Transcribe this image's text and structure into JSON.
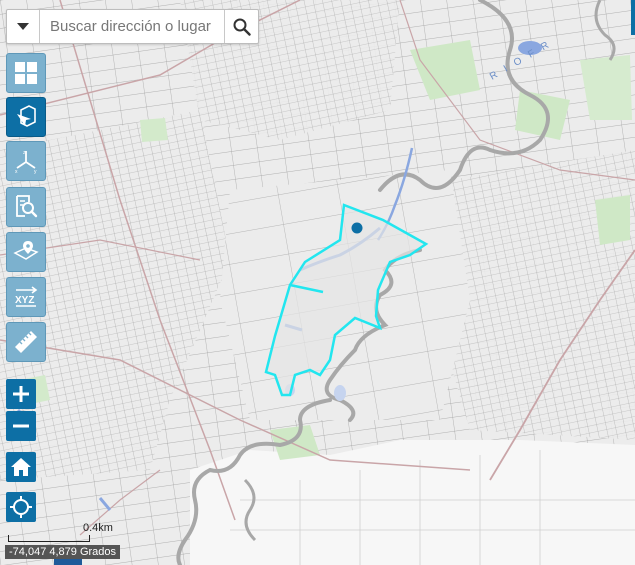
{
  "search": {
    "placeholder": "Buscar dirección o lugar"
  },
  "toolbar": {
    "tools": [
      {
        "name": "basemap-gallery",
        "icon": "grid-icon",
        "active": false
      },
      {
        "name": "layer-list",
        "icon": "layers-pointer-icon",
        "active": true
      },
      {
        "name": "coordinate-conversion",
        "icon": "xyz-axes-icon",
        "active": false
      },
      {
        "name": "identify",
        "icon": "document-search-icon",
        "active": false
      },
      {
        "name": "locate-on-map",
        "icon": "map-pin-icon",
        "active": false
      },
      {
        "name": "xyz-coordinates",
        "icon": "xyz-icon",
        "active": false
      },
      {
        "name": "measurement",
        "icon": "ruler-icon",
        "active": false
      }
    ],
    "xyz_label": "XYZ"
  },
  "zoom": {
    "in_label": "+",
    "out_label": "−"
  },
  "scale": {
    "label": "0.4km"
  },
  "coordinates": {
    "label": "-74,047 4,879 Grados"
  },
  "map": {
    "river_label": "R I O F R",
    "colors": {
      "background": "#ececec",
      "parcel_lines": "#8a8a8a",
      "roads": "#c9a5a8",
      "green": "#cfe8c6",
      "water": "#8aa7e0",
      "highlight": "#22e6ef",
      "accent": "#0d6fa5",
      "urban_light": "#f7f7f7"
    }
  }
}
